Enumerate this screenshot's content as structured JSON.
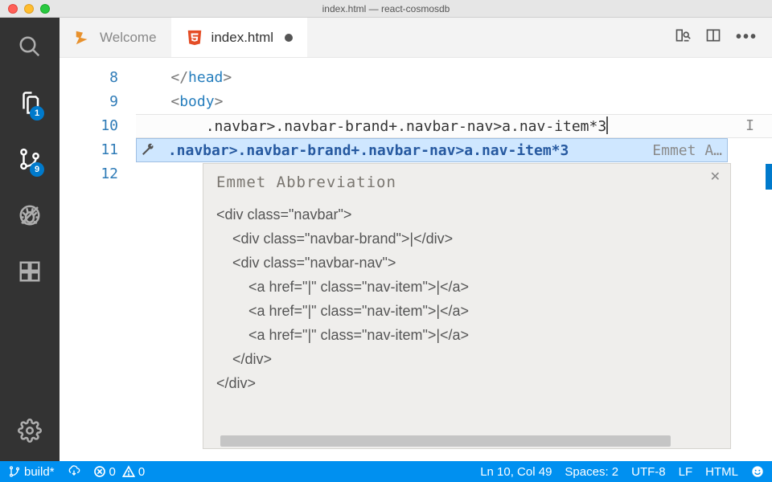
{
  "window": {
    "title": "index.html — react-cosmosdb"
  },
  "activity": {
    "files_badge": "1",
    "git_badge": "9"
  },
  "tabs": {
    "welcome": "Welcome",
    "file": "index.html"
  },
  "gutter": [
    "8",
    "9",
    "10",
    "11",
    "12"
  ],
  "code": {
    "l8": [
      "    ",
      "</",
      "head",
      ">"
    ],
    "l9": [
      "    ",
      "<",
      "body",
      ">"
    ],
    "l10": "        .navbar>.navbar-brand+.navbar-nav>a.nav-item*3"
  },
  "suggest": {
    "abbr": " .navbar>.navbar-brand+.navbar-nav>a.nav-item*3",
    "hint": "Emmet A…"
  },
  "preview": {
    "heading": "Emmet Abbreviation",
    "body": "<div class=\"navbar\">\n    <div class=\"navbar-brand\">|</div>\n    <div class=\"navbar-nav\">\n        <a href=\"|\" class=\"nav-item\">|</a>\n        <a href=\"|\" class=\"nav-item\">|</a>\n        <a href=\"|\" class=\"nav-item\">|</a>\n    </div>\n</div>"
  },
  "status": {
    "branch": "build*",
    "errors": "0",
    "warnings": "0",
    "lncol": "Ln 10, Col 49",
    "spaces": "Spaces: 2",
    "encoding": "UTF-8",
    "eol": "LF",
    "lang": "HTML"
  }
}
